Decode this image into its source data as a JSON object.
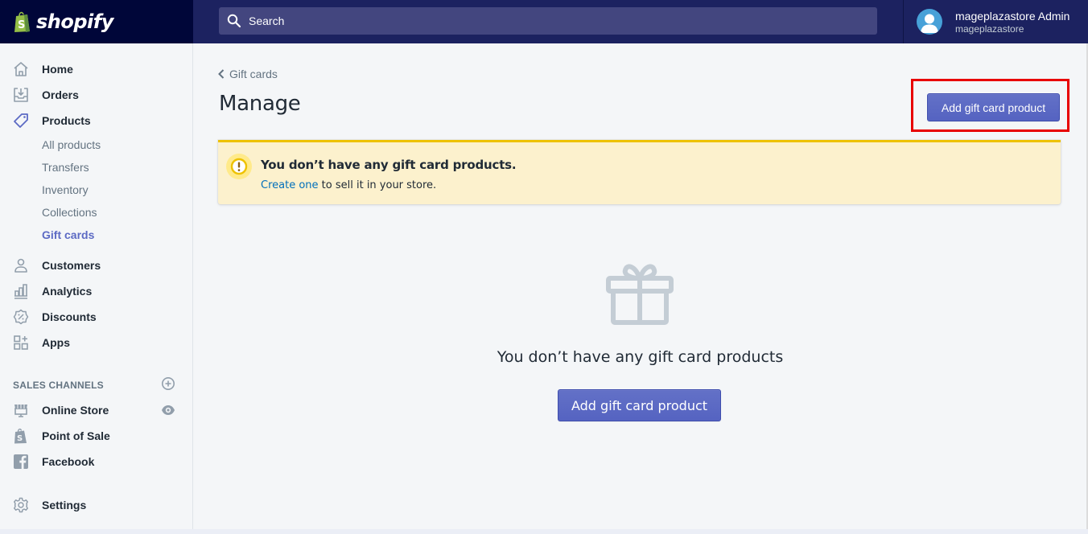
{
  "app": {
    "brand": "shopify",
    "colors": {
      "topbar": "#1c2260",
      "logo_bg": "#000639",
      "accent": "#5c6ac4",
      "warning_bg": "#fcf1cd",
      "warning_border": "#eec200",
      "link": "#006fbb",
      "highlight": "#e80000"
    }
  },
  "topbar": {
    "search_placeholder": "Search",
    "search_icon": "search-icon",
    "user": {
      "name": "mageplazastore Admin",
      "shop": "mageplazastore",
      "avatar_icon": "user-avatar-icon"
    }
  },
  "sidebar": {
    "items": [
      {
        "label": "Home",
        "icon": "home-icon"
      },
      {
        "label": "Orders",
        "icon": "orders-icon"
      },
      {
        "label": "Products",
        "icon": "tag-icon",
        "active": true
      },
      {
        "label": "Customers",
        "icon": "customer-icon"
      },
      {
        "label": "Analytics",
        "icon": "analytics-icon"
      },
      {
        "label": "Discounts",
        "icon": "discount-icon"
      },
      {
        "label": "Apps",
        "icon": "apps-icon"
      }
    ],
    "product_subitems": [
      {
        "label": "All products"
      },
      {
        "label": "Transfers"
      },
      {
        "label": "Inventory"
      },
      {
        "label": "Collections"
      },
      {
        "label": "Gift cards",
        "active": true
      }
    ],
    "sales_channels": {
      "title": "SALES CHANNELS",
      "add_icon": "plus-circle-icon",
      "items": [
        {
          "label": "Online Store",
          "icon": "store-icon",
          "action_icon": "eye-icon"
        },
        {
          "label": "Point of Sale",
          "icon": "shopify-bag-icon"
        },
        {
          "label": "Facebook",
          "icon": "facebook-icon"
        }
      ]
    },
    "settings": {
      "label": "Settings",
      "icon": "gear-icon"
    }
  },
  "main": {
    "breadcrumb": "Gift cards",
    "title": "Manage",
    "add_button": "Add gift card product",
    "banner": {
      "title": "You don’t have any gift card products.",
      "link_text": "Create one",
      "body_rest": " to sell it in your store."
    },
    "empty_state": {
      "icon": "gift-icon",
      "text": "You don’t have any gift card products",
      "button": "Add gift card product"
    }
  }
}
